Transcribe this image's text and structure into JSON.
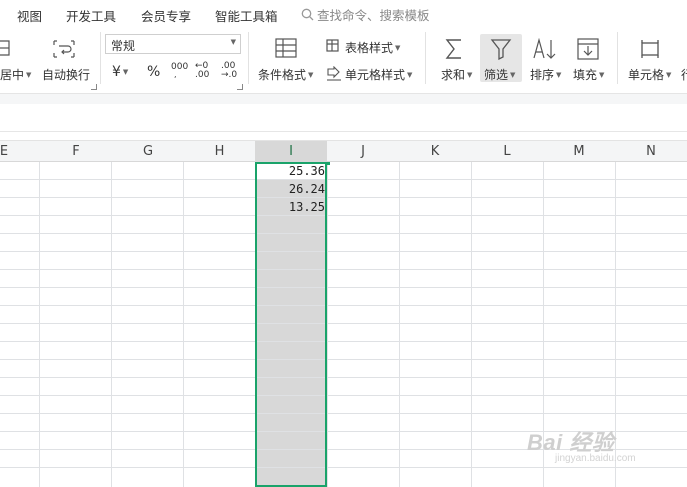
{
  "menu": {
    "items": [
      "视图",
      "开发工具",
      "会员专享",
      "智能工具箱"
    ],
    "search_placeholder": "查找命令、搜索模板"
  },
  "ribbon": {
    "align_center_label": "居中",
    "wrap_text_label": "自动换行",
    "number_format_value": "常规",
    "currency_symbol": "¥",
    "percent_symbol": "%",
    "comma_symbol": "000",
    "decrease_decimal_top": "←0",
    "decrease_decimal_bottom": ".00",
    "increase_decimal_top": ".00",
    "increase_decimal_bottom": "→.0",
    "conditional_format_label": "条件格式",
    "table_style_label": "表格样式",
    "cell_style_label": "单元格样式",
    "sum_label": "求和",
    "filter_label": "筛选",
    "sort_label": "排序",
    "fill_label": "填充",
    "cell_label": "单元格",
    "cut_off_label": "行"
  },
  "columns": [
    "E",
    "F",
    "G",
    "H",
    "I",
    "J",
    "K",
    "L",
    "M",
    "N"
  ],
  "selected_column": "I",
  "cells": [
    {
      "address": "I2",
      "value": "25.36"
    },
    {
      "address": "I3",
      "value": "26.24"
    },
    {
      "address": "I4",
      "value": "13.25"
    }
  ],
  "watermark": {
    "brand": "Bai 经验",
    "url": "jingyan.baidu.com"
  },
  "colors": {
    "selection_border": "#1aa36a",
    "selection_fill": "#d8d8d8",
    "selected_header_text": "#217346"
  }
}
